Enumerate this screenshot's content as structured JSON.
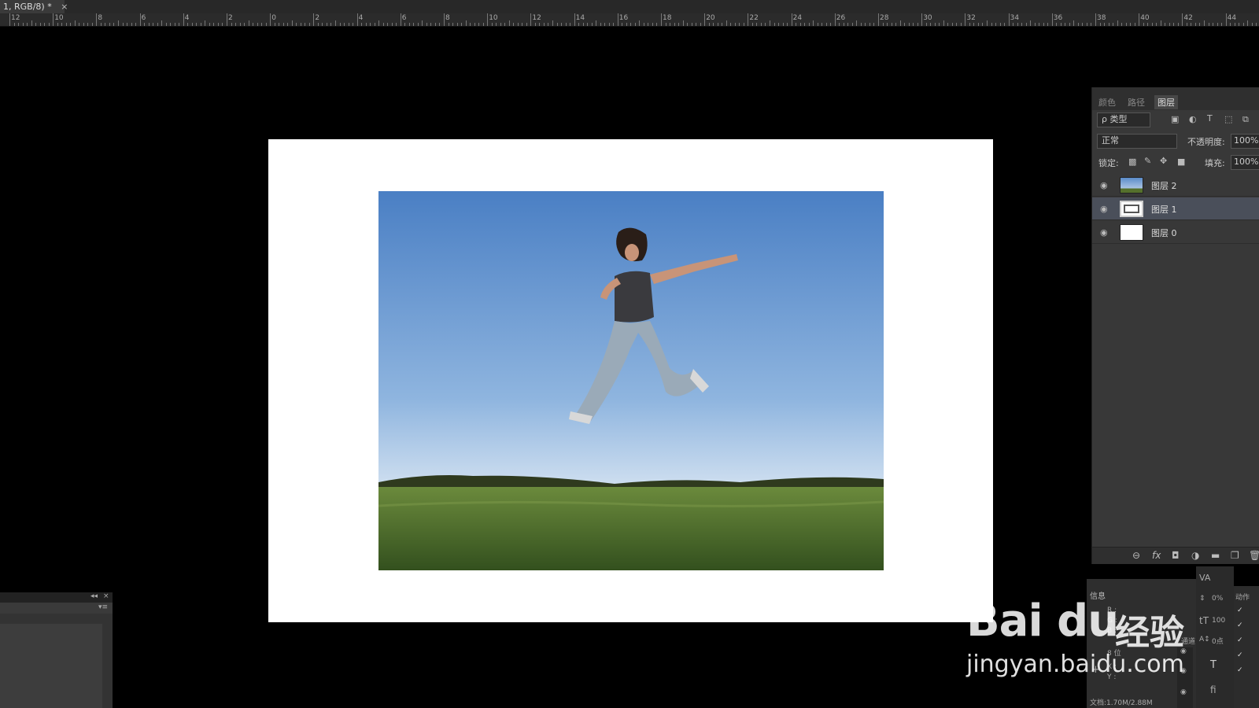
{
  "document_tab": {
    "title": "1, RGB/8) *",
    "close": "×"
  },
  "ruler": {
    "labels": [
      "12",
      "10",
      "8",
      "6",
      "4",
      "2",
      "0",
      "2",
      "4",
      "6",
      "8",
      "10",
      "12",
      "14",
      "16",
      "18",
      "20",
      "22",
      "24",
      "26",
      "28",
      "30",
      "32",
      "34",
      "36",
      "38",
      "40",
      "42",
      "44"
    ]
  },
  "layers_panel": {
    "tabs": [
      "颜色",
      "路径",
      "图层"
    ],
    "active_tab": "图层",
    "filter_kind": "ρ 类型",
    "blend_mode": "正常",
    "opacity_label": "不透明度:",
    "opacity_value": "100%",
    "lock_label": "锁定:",
    "fill_label": "填充:",
    "fill_value": "100%",
    "layers": [
      {
        "name": "图层 2",
        "selected": false
      },
      {
        "name": "图层 1",
        "selected": true
      },
      {
        "name": "图层 0",
        "selected": false
      }
    ]
  },
  "info_panel": {
    "title": "信息",
    "r": "R :",
    "g": "G :",
    "b": "B :",
    "bits": "8 位",
    "channels": "通道",
    "x": "X :",
    "y": "Y :",
    "doc": "文档:1.70M/2.88M"
  },
  "char_panel": {
    "va": "VA",
    "pct": "0%",
    "size": "100",
    "baseline": "0点"
  },
  "actions_panel": {
    "title": "动作"
  },
  "watermark": {
    "logo": "Bai du",
    "cn": "经验",
    "url": "jingyan.baidu.com"
  },
  "colors": {
    "sky_top": "#4a7fc4",
    "sky_bottom": "#cfdff0",
    "grass": "#4a6a2a",
    "panel": "#383838"
  }
}
